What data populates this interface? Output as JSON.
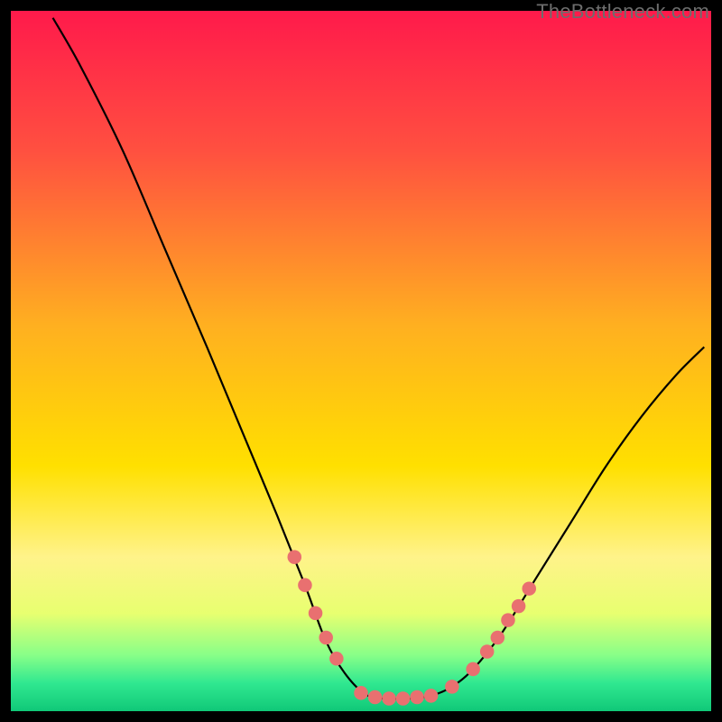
{
  "watermark": "TheBottleneck.com",
  "chart_data": {
    "type": "line",
    "title": "",
    "xlabel": "",
    "ylabel": "",
    "xlim": [
      0,
      100
    ],
    "ylim": [
      0,
      100
    ],
    "grid": false,
    "legend": false,
    "background_gradient_stops": [
      {
        "offset": 0.0,
        "color": "#ff1a4b"
      },
      {
        "offset": 0.2,
        "color": "#ff5040"
      },
      {
        "offset": 0.45,
        "color": "#ffb020"
      },
      {
        "offset": 0.65,
        "color": "#ffe000"
      },
      {
        "offset": 0.78,
        "color": "#fff38a"
      },
      {
        "offset": 0.86,
        "color": "#e8ff70"
      },
      {
        "offset": 0.92,
        "color": "#88ff88"
      },
      {
        "offset": 0.96,
        "color": "#30e890"
      },
      {
        "offset": 1.0,
        "color": "#10c878"
      }
    ],
    "curve": {
      "stroke": "#000000",
      "points": [
        {
          "x": 6.0,
          "y": 99.0
        },
        {
          "x": 10.0,
          "y": 92.0
        },
        {
          "x": 16.0,
          "y": 80.0
        },
        {
          "x": 22.0,
          "y": 66.0
        },
        {
          "x": 28.0,
          "y": 52.0
        },
        {
          "x": 33.0,
          "y": 40.0
        },
        {
          "x": 38.0,
          "y": 28.0
        },
        {
          "x": 42.0,
          "y": 18.0
        },
        {
          "x": 45.0,
          "y": 10.0
        },
        {
          "x": 48.0,
          "y": 5.0
        },
        {
          "x": 51.0,
          "y": 2.2
        },
        {
          "x": 54.0,
          "y": 1.8
        },
        {
          "x": 57.0,
          "y": 1.8
        },
        {
          "x": 60.0,
          "y": 2.2
        },
        {
          "x": 63.0,
          "y": 3.5
        },
        {
          "x": 66.0,
          "y": 6.0
        },
        {
          "x": 70.0,
          "y": 11.0
        },
        {
          "x": 75.0,
          "y": 19.0
        },
        {
          "x": 80.0,
          "y": 27.0
        },
        {
          "x": 85.0,
          "y": 35.0
        },
        {
          "x": 90.0,
          "y": 42.0
        },
        {
          "x": 95.0,
          "y": 48.0
        },
        {
          "x": 99.0,
          "y": 52.0
        }
      ]
    },
    "markers": {
      "color": "#e97070",
      "radius_pct": 1.0,
      "points": [
        {
          "x": 40.5,
          "y": 22.0
        },
        {
          "x": 42.0,
          "y": 18.0
        },
        {
          "x": 43.5,
          "y": 14.0
        },
        {
          "x": 45.0,
          "y": 10.5
        },
        {
          "x": 46.5,
          "y": 7.5
        },
        {
          "x": 50.0,
          "y": 2.6
        },
        {
          "x": 52.0,
          "y": 2.0
        },
        {
          "x": 54.0,
          "y": 1.8
        },
        {
          "x": 56.0,
          "y": 1.8
        },
        {
          "x": 58.0,
          "y": 2.0
        },
        {
          "x": 60.0,
          "y": 2.2
        },
        {
          "x": 63.0,
          "y": 3.5
        },
        {
          "x": 66.0,
          "y": 6.0
        },
        {
          "x": 68.0,
          "y": 8.5
        },
        {
          "x": 69.5,
          "y": 10.5
        },
        {
          "x": 71.0,
          "y": 13.0
        },
        {
          "x": 72.5,
          "y": 15.0
        },
        {
          "x": 74.0,
          "y": 17.5
        }
      ]
    }
  }
}
